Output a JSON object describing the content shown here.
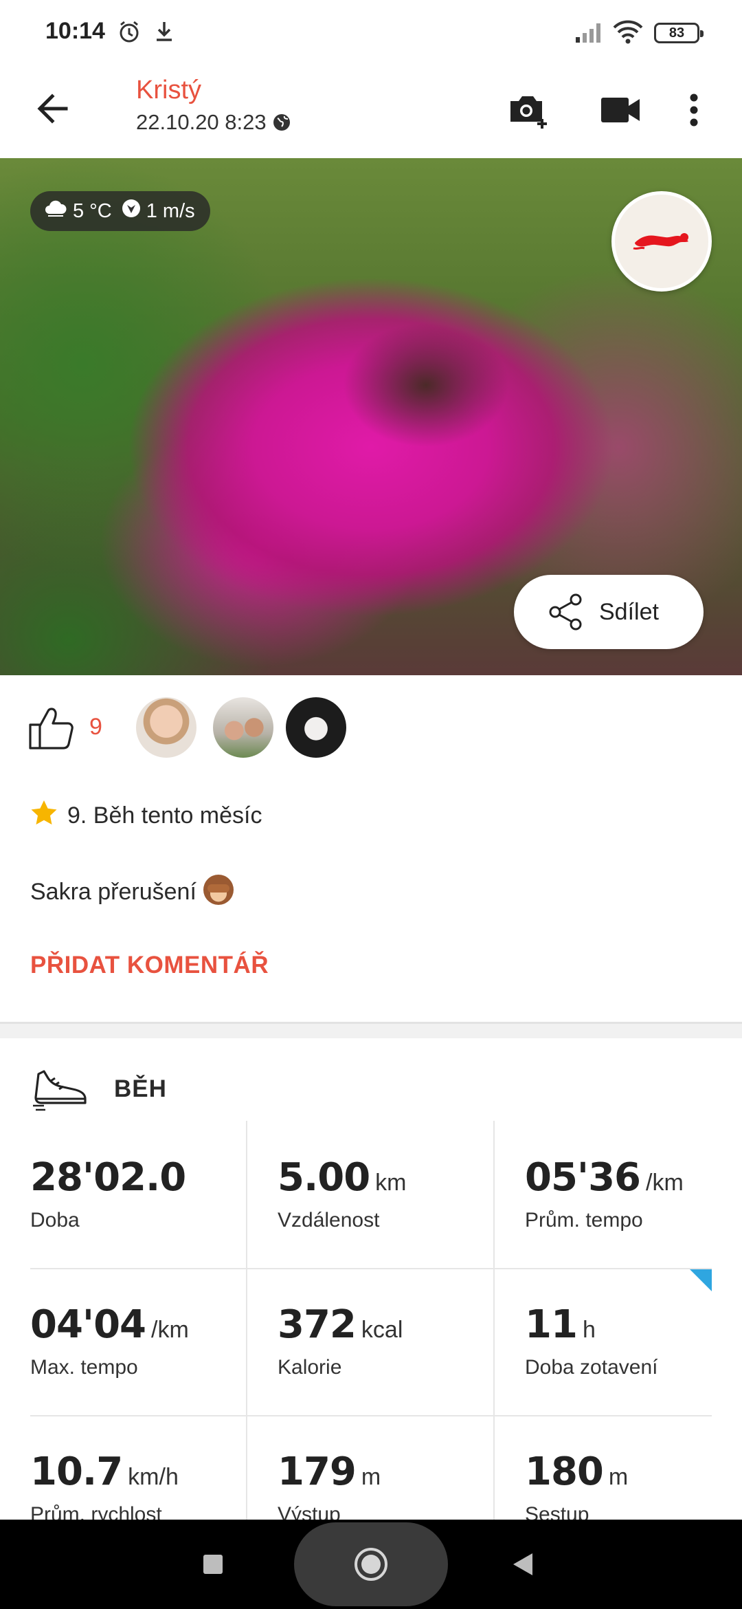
{
  "status_bar": {
    "time": "10:14",
    "battery": "83",
    "icons": [
      "alarm-icon",
      "download-icon",
      "signal-icon",
      "wifi-icon",
      "battery-icon"
    ]
  },
  "header": {
    "user_name": "Kristý",
    "date": "22.10.20 8:23",
    "icons": [
      "back-arrow-icon",
      "globe-icon",
      "add-photo-icon",
      "video-camera-icon",
      "more-vert-icon"
    ]
  },
  "photo": {
    "weather": {
      "temperature": "5 °C",
      "wind": "1 m/s"
    },
    "sport_badge_icon": "swimmer-icon",
    "share_label": "Sdílet"
  },
  "likes": {
    "count": "9",
    "avatars": [
      "avatar-1",
      "avatar-2",
      "avatar-3"
    ]
  },
  "post": {
    "rank_text": "9. Běh tento měsíc",
    "description": "Sakra přerušení",
    "add_comment_label": "PŘIDAT KOMENTÁŘ"
  },
  "workout": {
    "type": "BĚH",
    "stats": [
      {
        "value": "28'02.0",
        "unit": "",
        "label": "Doba"
      },
      {
        "value": "5.00",
        "unit": "km",
        "label": "Vzdálenost"
      },
      {
        "value": "05'36",
        "unit": "/km",
        "label": "Prům. tempo"
      },
      {
        "value": "04'04",
        "unit": "/km",
        "label": "Max. tempo"
      },
      {
        "value": "372",
        "unit": "kcal",
        "label": "Kalorie"
      },
      {
        "value": "11",
        "unit": "h",
        "label": "Doba zotavení"
      },
      {
        "value": "10.7",
        "unit": "km/h",
        "label": "Prům. rychlost"
      },
      {
        "value": "179",
        "unit": "m",
        "label": "Výstup"
      },
      {
        "value": "180",
        "unit": "m",
        "label": "Sestup"
      }
    ]
  },
  "colors": {
    "accent": "#e8523f",
    "text": "#2a2a2a",
    "flag": "#2fa6e0"
  }
}
